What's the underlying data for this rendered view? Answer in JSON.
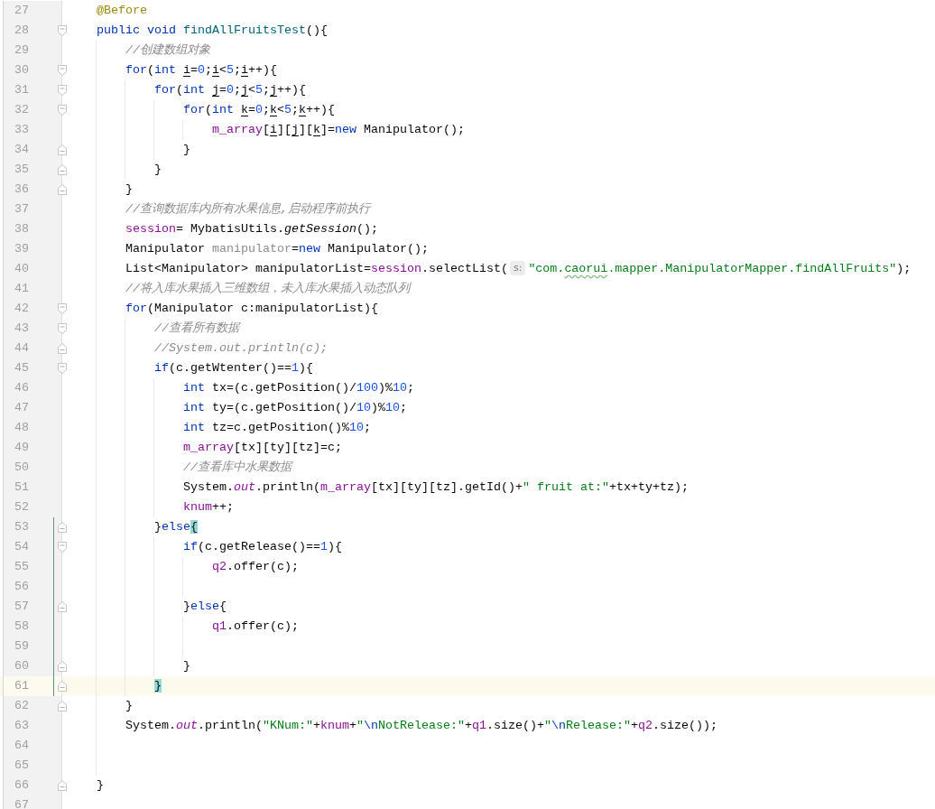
{
  "editor": {
    "lines": [
      {
        "number": "27",
        "fold_start": false,
        "fold_end": false,
        "current": false,
        "scope_bar": false,
        "tokens": [
          {
            "kind": "annotation",
            "text": "    @Before"
          }
        ]
      },
      {
        "number": "28",
        "fold_start": true,
        "fold_end": false,
        "current": false,
        "scope_bar": false,
        "tokens": [
          {
            "kind": "keyword",
            "text": "    public "
          },
          {
            "kind": "keyword",
            "text": "void "
          },
          {
            "kind": "method",
            "text": "findAllFruitsTest"
          },
          {
            "kind": "plain",
            "text": "(){"
          }
        ]
      },
      {
        "number": "29",
        "fold_start": false,
        "fold_end": false,
        "current": false,
        "scope_bar": false,
        "tokens": [
          {
            "kind": "comment",
            "text": "        //创建数组对象"
          }
        ]
      },
      {
        "number": "30",
        "fold_start": true,
        "fold_end": false,
        "current": false,
        "scope_bar": false,
        "tokens": [
          {
            "kind": "keyword",
            "text": "        for"
          },
          {
            "kind": "plain",
            "text": "("
          },
          {
            "kind": "keyword",
            "text": "int "
          },
          {
            "kind": "variable",
            "text": "i"
          },
          {
            "kind": "plain",
            "text": "="
          },
          {
            "kind": "number",
            "text": "0"
          },
          {
            "kind": "plain",
            "text": ";"
          },
          {
            "kind": "variable",
            "text": "i"
          },
          {
            "kind": "plain",
            "text": "<"
          },
          {
            "kind": "number",
            "text": "5"
          },
          {
            "kind": "plain",
            "text": ";"
          },
          {
            "kind": "variable",
            "text": "i"
          },
          {
            "kind": "plain",
            "text": "++){"
          }
        ]
      },
      {
        "number": "31",
        "fold_start": true,
        "fold_end": false,
        "current": false,
        "scope_bar": false,
        "tokens": [
          {
            "kind": "keyword",
            "text": "            for"
          },
          {
            "kind": "plain",
            "text": "("
          },
          {
            "kind": "keyword",
            "text": "int "
          },
          {
            "kind": "variable",
            "text": "j"
          },
          {
            "kind": "plain",
            "text": "="
          },
          {
            "kind": "number",
            "text": "0"
          },
          {
            "kind": "plain",
            "text": ";"
          },
          {
            "kind": "variable",
            "text": "j"
          },
          {
            "kind": "plain",
            "text": "<"
          },
          {
            "kind": "number",
            "text": "5"
          },
          {
            "kind": "plain",
            "text": ";"
          },
          {
            "kind": "variable",
            "text": "j"
          },
          {
            "kind": "plain",
            "text": "++){"
          }
        ]
      },
      {
        "number": "32",
        "fold_start": true,
        "fold_end": false,
        "current": false,
        "scope_bar": false,
        "tokens": [
          {
            "kind": "keyword",
            "text": "                for"
          },
          {
            "kind": "plain",
            "text": "("
          },
          {
            "kind": "keyword",
            "text": "int "
          },
          {
            "kind": "variable",
            "text": "k"
          },
          {
            "kind": "plain",
            "text": "="
          },
          {
            "kind": "number",
            "text": "0"
          },
          {
            "kind": "plain",
            "text": ";"
          },
          {
            "kind": "variable",
            "text": "k"
          },
          {
            "kind": "plain",
            "text": "<"
          },
          {
            "kind": "number",
            "text": "5"
          },
          {
            "kind": "plain",
            "text": ";"
          },
          {
            "kind": "variable",
            "text": "k"
          },
          {
            "kind": "plain",
            "text": "++){"
          }
        ]
      },
      {
        "number": "33",
        "fold_start": false,
        "fold_end": false,
        "current": false,
        "scope_bar": false,
        "tokens": [
          {
            "kind": "field",
            "text": "                    m_array"
          },
          {
            "kind": "plain",
            "text": "["
          },
          {
            "kind": "variable",
            "text": "i"
          },
          {
            "kind": "plain",
            "text": "]["
          },
          {
            "kind": "variable",
            "text": "j"
          },
          {
            "kind": "plain",
            "text": "]["
          },
          {
            "kind": "variable",
            "text": "k"
          },
          {
            "kind": "plain",
            "text": "]="
          },
          {
            "kind": "keyword",
            "text": "new"
          },
          {
            "kind": "plain",
            "text": " Manipulator();"
          }
        ]
      },
      {
        "number": "34",
        "fold_start": false,
        "fold_end": true,
        "current": false,
        "scope_bar": false,
        "tokens": [
          {
            "kind": "plain",
            "text": "                }"
          }
        ]
      },
      {
        "number": "35",
        "fold_start": false,
        "fold_end": true,
        "current": false,
        "scope_bar": false,
        "tokens": [
          {
            "kind": "plain",
            "text": "            }"
          }
        ]
      },
      {
        "number": "36",
        "fold_start": false,
        "fold_end": true,
        "current": false,
        "scope_bar": false,
        "tokens": [
          {
            "kind": "plain",
            "text": "        }"
          }
        ]
      },
      {
        "number": "37",
        "fold_start": false,
        "fold_end": false,
        "current": false,
        "scope_bar": false,
        "tokens": [
          {
            "kind": "comment",
            "text": "        //查询数据库内所有水果信息,启动程序前执行"
          }
        ]
      },
      {
        "number": "38",
        "fold_start": false,
        "fold_end": false,
        "current": false,
        "scope_bar": false,
        "tokens": [
          {
            "kind": "field",
            "text": "        session"
          },
          {
            "kind": "plain",
            "text": "= MybatisUtils."
          },
          {
            "kind": "static-call",
            "text": "getSession"
          },
          {
            "kind": "plain",
            "text": "();"
          }
        ]
      },
      {
        "number": "39",
        "fold_start": false,
        "fold_end": false,
        "current": false,
        "scope_bar": false,
        "tokens": [
          {
            "kind": "plain",
            "text": "        Manipulator "
          },
          {
            "kind": "unused",
            "text": "manipulator"
          },
          {
            "kind": "plain",
            "text": "="
          },
          {
            "kind": "keyword",
            "text": "new"
          },
          {
            "kind": "plain",
            "text": " Manipulator();"
          }
        ]
      },
      {
        "number": "40",
        "fold_start": false,
        "fold_end": false,
        "current": false,
        "scope_bar": false,
        "tokens": [
          {
            "kind": "plain",
            "text": "        List<Manipulator> manipulatorList="
          },
          {
            "kind": "field",
            "text": "session"
          },
          {
            "kind": "plain",
            "text": ".selectList("
          },
          {
            "kind": "hint",
            "text": "s:"
          },
          {
            "kind": "string",
            "text": "\"com."
          },
          {
            "kind": "typo",
            "text": "caorui"
          },
          {
            "kind": "string",
            "text": ".mapper.ManipulatorMapper.findAllFruits\""
          },
          {
            "kind": "plain",
            "text": ");"
          }
        ]
      },
      {
        "number": "41",
        "fold_start": false,
        "fold_end": false,
        "current": false,
        "scope_bar": false,
        "tokens": [
          {
            "kind": "comment",
            "text": "        //将入库水果插入三维数组，未入库水果插入动态队列"
          }
        ]
      },
      {
        "number": "42",
        "fold_start": true,
        "fold_end": false,
        "current": false,
        "scope_bar": false,
        "tokens": [
          {
            "kind": "keyword",
            "text": "        for"
          },
          {
            "kind": "plain",
            "text": "(Manipulator c:manipulatorList){"
          }
        ]
      },
      {
        "number": "43",
        "fold_start": true,
        "fold_end": false,
        "current": false,
        "scope_bar": false,
        "tokens": [
          {
            "kind": "comment",
            "text": "            //查看所有数据"
          }
        ]
      },
      {
        "number": "44",
        "fold_start": false,
        "fold_end": true,
        "current": false,
        "scope_bar": false,
        "tokens": [
          {
            "kind": "comment",
            "text": "            //System.out.println(c);"
          }
        ]
      },
      {
        "number": "45",
        "fold_start": true,
        "fold_end": false,
        "current": false,
        "scope_bar": false,
        "tokens": [
          {
            "kind": "keyword",
            "text": "            if"
          },
          {
            "kind": "plain",
            "text": "(c.getWtenter()=="
          },
          {
            "kind": "number",
            "text": "1"
          },
          {
            "kind": "plain",
            "text": "){"
          }
        ]
      },
      {
        "number": "46",
        "fold_start": false,
        "fold_end": false,
        "current": false,
        "scope_bar": false,
        "tokens": [
          {
            "kind": "keyword",
            "text": "                int"
          },
          {
            "kind": "plain",
            "text": " tx=(c.getPosition()/"
          },
          {
            "kind": "number",
            "text": "100"
          },
          {
            "kind": "plain",
            "text": ")%"
          },
          {
            "kind": "number",
            "text": "10"
          },
          {
            "kind": "plain",
            "text": ";"
          }
        ]
      },
      {
        "number": "47",
        "fold_start": false,
        "fold_end": false,
        "current": false,
        "scope_bar": false,
        "tokens": [
          {
            "kind": "keyword",
            "text": "                int"
          },
          {
            "kind": "plain",
            "text": " ty=(c.getPosition()/"
          },
          {
            "kind": "number",
            "text": "10"
          },
          {
            "kind": "plain",
            "text": ")%"
          },
          {
            "kind": "number",
            "text": "10"
          },
          {
            "kind": "plain",
            "text": ";"
          }
        ]
      },
      {
        "number": "48",
        "fold_start": false,
        "fold_end": false,
        "current": false,
        "scope_bar": false,
        "tokens": [
          {
            "kind": "keyword",
            "text": "                int"
          },
          {
            "kind": "plain",
            "text": " tz=c.getPosition()%"
          },
          {
            "kind": "number",
            "text": "10"
          },
          {
            "kind": "plain",
            "text": ";"
          }
        ]
      },
      {
        "number": "49",
        "fold_start": false,
        "fold_end": false,
        "current": false,
        "scope_bar": false,
        "tokens": [
          {
            "kind": "field",
            "text": "                m_array"
          },
          {
            "kind": "plain",
            "text": "[tx][ty][tz]=c;"
          }
        ]
      },
      {
        "number": "50",
        "fold_start": false,
        "fold_end": false,
        "current": false,
        "scope_bar": false,
        "tokens": [
          {
            "kind": "comment",
            "text": "                //查看库中水果数据"
          }
        ]
      },
      {
        "number": "51",
        "fold_start": false,
        "fold_end": false,
        "current": false,
        "scope_bar": false,
        "tokens": [
          {
            "kind": "plain",
            "text": "                System."
          },
          {
            "kind": "static-field",
            "text": "out"
          },
          {
            "kind": "plain",
            "text": ".println("
          },
          {
            "kind": "field",
            "text": "m_array"
          },
          {
            "kind": "plain",
            "text": "[tx][ty][tz].getId()+"
          },
          {
            "kind": "string",
            "text": "\" fruit at:\""
          },
          {
            "kind": "plain",
            "text": "+tx+ty+tz);"
          }
        ]
      },
      {
        "number": "52",
        "fold_start": false,
        "fold_end": false,
        "current": false,
        "scope_bar": false,
        "tokens": [
          {
            "kind": "field",
            "text": "                knum"
          },
          {
            "kind": "plain",
            "text": "++;"
          }
        ]
      },
      {
        "number": "53",
        "fold_start": false,
        "fold_end": true,
        "current": false,
        "scope_bar": true,
        "tokens": [
          {
            "kind": "plain",
            "text": "            }"
          },
          {
            "kind": "keyword",
            "text": "else"
          },
          {
            "kind": "brace-match",
            "text": "{"
          }
        ]
      },
      {
        "number": "54",
        "fold_start": true,
        "fold_end": false,
        "current": false,
        "scope_bar": true,
        "tokens": [
          {
            "kind": "keyword",
            "text": "                if"
          },
          {
            "kind": "plain",
            "text": "(c.getRelease()=="
          },
          {
            "kind": "number",
            "text": "1"
          },
          {
            "kind": "plain",
            "text": "){"
          }
        ]
      },
      {
        "number": "55",
        "fold_start": false,
        "fold_end": false,
        "current": false,
        "scope_bar": true,
        "tokens": [
          {
            "kind": "field",
            "text": "                    q2"
          },
          {
            "kind": "plain",
            "text": ".offer(c);"
          }
        ]
      },
      {
        "number": "56",
        "fold_start": false,
        "fold_end": false,
        "current": false,
        "scope_bar": true
      },
      {
        "number": "57",
        "fold_start": false,
        "fold_end": true,
        "current": false,
        "scope_bar": true,
        "tokens": [
          {
            "kind": "plain",
            "text": "                }"
          },
          {
            "kind": "keyword",
            "text": "else"
          },
          {
            "kind": "plain",
            "text": "{"
          }
        ]
      },
      {
        "number": "58",
        "fold_start": false,
        "fold_end": false,
        "current": false,
        "scope_bar": true,
        "tokens": [
          {
            "kind": "field",
            "text": "                    q1"
          },
          {
            "kind": "plain",
            "text": ".offer(c);"
          }
        ]
      },
      {
        "number": "59",
        "fold_start": false,
        "fold_end": false,
        "current": false,
        "scope_bar": true
      },
      {
        "number": "60",
        "fold_start": false,
        "fold_end": true,
        "current": false,
        "scope_bar": true,
        "tokens": [
          {
            "kind": "plain",
            "text": "                }"
          }
        ]
      },
      {
        "number": "61",
        "fold_start": false,
        "fold_end": true,
        "current": true,
        "scope_bar": true,
        "tokens": [
          {
            "kind": "brace-match",
            "text": "            }"
          }
        ]
      },
      {
        "number": "62",
        "fold_start": false,
        "fold_end": true,
        "current": false,
        "scope_bar": false,
        "tokens": [
          {
            "kind": "plain",
            "text": "        }"
          }
        ]
      },
      {
        "number": "63",
        "fold_start": false,
        "fold_end": false,
        "current": false,
        "scope_bar": false,
        "tokens": [
          {
            "kind": "plain",
            "text": "        System."
          },
          {
            "kind": "static-field",
            "text": "out"
          },
          {
            "kind": "plain",
            "text": ".println("
          },
          {
            "kind": "string",
            "text": "\"KNum:\""
          },
          {
            "kind": "plain",
            "text": "+"
          },
          {
            "kind": "field",
            "text": "knum"
          },
          {
            "kind": "plain",
            "text": "+"
          },
          {
            "kind": "string",
            "text": "\""
          },
          {
            "kind": "escape",
            "text": "\\n"
          },
          {
            "kind": "string",
            "text": "NotRelease:\""
          },
          {
            "kind": "plain",
            "text": "+"
          },
          {
            "kind": "field",
            "text": "q1"
          },
          {
            "kind": "plain",
            "text": ".size()+"
          },
          {
            "kind": "string",
            "text": "\""
          },
          {
            "kind": "escape",
            "text": "\\n"
          },
          {
            "kind": "string",
            "text": "Release:\""
          },
          {
            "kind": "plain",
            "text": "+"
          },
          {
            "kind": "field",
            "text": "q2"
          },
          {
            "kind": "plain",
            "text": ".size());"
          }
        ]
      },
      {
        "number": "64",
        "fold_start": false,
        "fold_end": false,
        "current": false,
        "scope_bar": false
      },
      {
        "number": "65",
        "fold_start": false,
        "fold_end": false,
        "current": false,
        "scope_bar": false
      },
      {
        "number": "66",
        "fold_start": false,
        "fold_end": true,
        "current": false,
        "scope_bar": false,
        "tokens": [
          {
            "kind": "plain",
            "text": "    }"
          }
        ]
      },
      {
        "number": "67",
        "fold_start": false,
        "fold_end": false,
        "current": false,
        "scope_bar": false
      }
    ]
  }
}
